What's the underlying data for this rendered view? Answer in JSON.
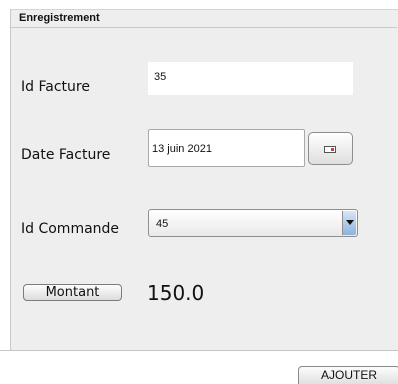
{
  "panel": {
    "title": "Enregistrement"
  },
  "form": {
    "id_facture": {
      "label": "Id Facture",
      "value": "35"
    },
    "date_facture": {
      "label": "Date Facture",
      "value": "13 juin 2021"
    },
    "id_commande": {
      "label": "Id Commande",
      "selected": "45"
    },
    "montant": {
      "button_label": "Montant",
      "value": "150.0"
    }
  },
  "footer": {
    "ajouter_label": "AJOUTER"
  },
  "icons": {
    "calendar": "calendar-icon",
    "dropdown": "chevron-down-icon"
  },
  "colors": {
    "panel_bg": "#eeeeee",
    "field_bg": "#ffffff",
    "dropdown_arrow": "#8db2dc"
  }
}
